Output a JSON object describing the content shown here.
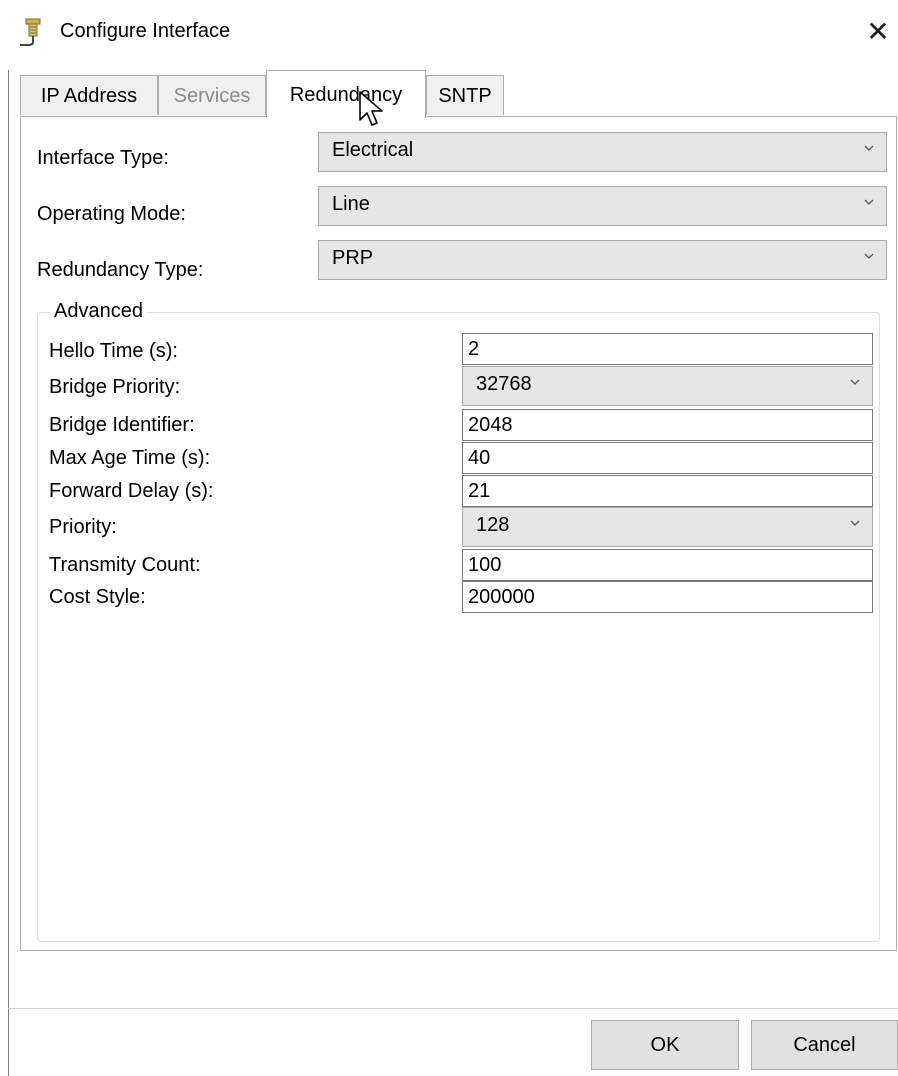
{
  "window": {
    "title": "Configure Interface",
    "close_glyph": "✕",
    "icon": "network-plug-icon"
  },
  "tabs": [
    {
      "label": "IP Address",
      "state": "normal"
    },
    {
      "label": "Services",
      "state": "disabled"
    },
    {
      "label": "Redundancy",
      "state": "active"
    },
    {
      "label": "SNTP",
      "state": "normal"
    }
  ],
  "form": {
    "interface_type": {
      "label": "Interface Type:",
      "value": "Electrical"
    },
    "operating_mode": {
      "label": "Operating Mode:",
      "value": "Line"
    },
    "redundancy_type": {
      "label": "Redundancy Type:",
      "value": "PRP"
    }
  },
  "advanced": {
    "legend": "Advanced",
    "hello_time": {
      "label": "Hello Time (s):",
      "value": "2"
    },
    "bridge_priority": {
      "label": "Bridge Priority:",
      "value": "32768"
    },
    "bridge_identifier": {
      "label": "Bridge Identifier:",
      "value": "2048"
    },
    "max_age_time": {
      "label": "Max Age Time (s):",
      "value": "40"
    },
    "forward_delay": {
      "label": "Forward Delay (s):",
      "value": "21"
    },
    "priority": {
      "label": "Priority:",
      "value": "128"
    },
    "transmity_count": {
      "label": "Transmity Count:",
      "value": "100"
    },
    "cost_style": {
      "label": "Cost Style:",
      "value": "200000"
    }
  },
  "buttons": {
    "ok": "OK",
    "cancel": "Cancel"
  },
  "colors": {
    "border": "#adadad",
    "combo_bg": "#e6e6e6",
    "button_bg": "#e1e1e1",
    "disabled_text": "#8a8a8a"
  }
}
